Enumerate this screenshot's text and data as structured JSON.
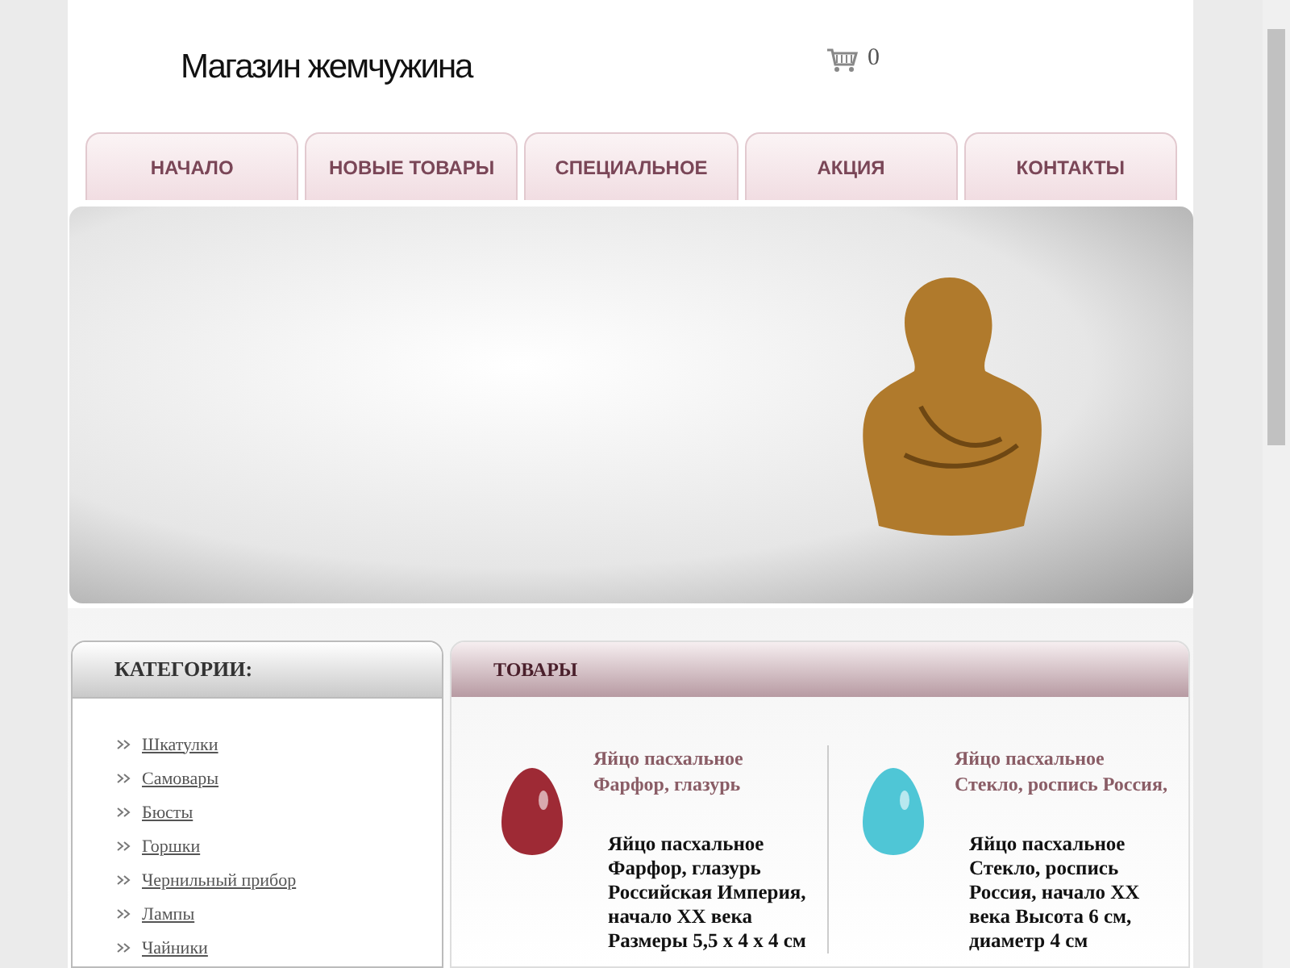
{
  "header": {
    "logo": "Магазин жемчужина",
    "cart_count": "0"
  },
  "nav": [
    {
      "label": "НАЧАЛО"
    },
    {
      "label": "НОВЫЕ ТОВАРЫ"
    },
    {
      "label": "СПЕЦИАЛЬНОЕ"
    },
    {
      "label": "АКЦИЯ"
    },
    {
      "label": "КОНТАКТЫ"
    }
  ],
  "sidebar": {
    "title": "КАТЕГОРИИ:",
    "items": [
      {
        "label": "Шкатулки"
      },
      {
        "label": "Самовары"
      },
      {
        "label": "Бюсты"
      },
      {
        "label": "Горшки"
      },
      {
        "label": "Чернильный прибор"
      },
      {
        "label": "Лампы"
      },
      {
        "label": "Чайники"
      }
    ]
  },
  "products": {
    "title": "ТОВАРЫ",
    "items": [
      {
        "name": "Яйцо пасхальное Фарфор, глазурь",
        "description": "Яйцо пасхальное Фарфор, глазурь Российская Империя, начало XX века Размеры 5,5 x 4 x 4 см",
        "color": "#9e2a35"
      },
      {
        "name": "Яйцо пасхальное Стекло, роспись Россия,",
        "description": "Яйцо пасхальное Стекло, роспись Россия, начало XX века Высота 6 см, диаметр 4 см",
        "color": "#4fc6d6"
      }
    ]
  }
}
